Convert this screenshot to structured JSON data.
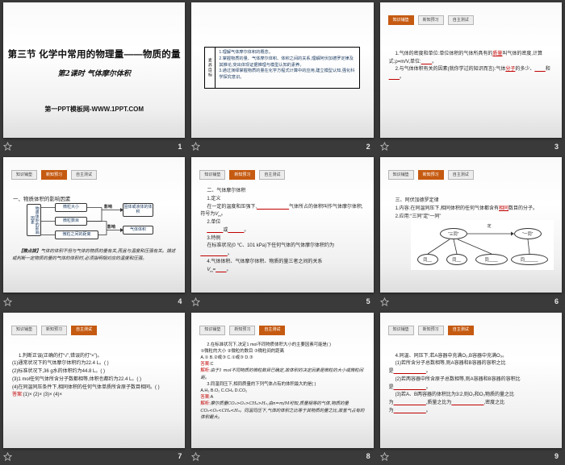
{
  "canvas": {
    "background": "#3A3A3A",
    "accent_orange": "#C55A11",
    "answer_red": "#C00000",
    "objective_blue": "#17375E"
  },
  "icons": {
    "transition_indicator": "star-icon"
  },
  "tabs": [
    "知识铺垫",
    "新知预习",
    "自主测试"
  ],
  "slides": {
    "s1": {
      "number": "1",
      "title": "第三节 化学中常用的物理量——物质的量",
      "subtitle": "第2课时  气体摩尔体积",
      "footer": "第一PPT模板网-WWW.1PPT.COM"
    },
    "s2": {
      "number": "2",
      "side_label": "素养目标",
      "items": [
        "1.理解气体摩尔体积的概念。",
        "2.掌握物质的量、气体摩尔体积、体积之间的关系,理解阿伏加德罗定律及其推论,突出体现证据推理与模型认知的素养。",
        "3.通过演绎掌握物质的量在化学方程式计算中的应用,建立模型认知,强化科学探究意识。"
      ]
    },
    "s3": {
      "number": "3",
      "active_tab": 0,
      "lines": [
        [
          {
            "t": "1.气体的密度和单位:单位体积的气体所具有的",
            "s": "n"
          },
          {
            "t": "质量",
            "s": "bl"
          },
          {
            "t": "叫气体的密度,计算式:ρ=m/V,单位:",
            "s": "n"
          },
          {
            "t": "____",
            "s": "bl"
          },
          {
            "t": "。",
            "s": "n"
          }
        ],
        [
          {
            "t": "2.与气体体积有关的因素(就你学过的知识而言):气体",
            "s": "n"
          },
          {
            "t": "分子",
            "s": "bl"
          },
          {
            "t": "的多少、",
            "s": "n"
          },
          {
            "t": "____",
            "s": "bl"
          },
          {
            "t": "和",
            "s": "n"
          },
          {
            "t": "____",
            "s": "bl"
          },
          {
            "t": "。",
            "s": "n"
          }
        ]
      ]
    },
    "s4": {
      "number": "4",
      "active_tab": 1,
      "heading": "一、物质体积的影响因素",
      "chart": {
        "root": "物质体积的影响因素",
        "factors": [
          "微粒大小",
          "微粒数目",
          "微粒之间的距离"
        ],
        "arrow_label": "影响",
        "outcomes": [
          "固体或液体的体积",
          "气体体积"
        ]
      },
      "note_label": "【微点拨】",
      "note": "气体的体积不但与气体的物质的量有关,而且与温度和压强有关。描述或判断一定物质的量的气体的体积时,必须指明相对应的温度和压强。"
    },
    "s5": {
      "number": "5",
      "active_tab": 1,
      "lines": [
        [
          {
            "t": "二、气体摩尔体积",
            "s": "n"
          }
        ],
        [
          {
            "t": "1.定义",
            "s": "n"
          }
        ],
        [
          {
            "t": "在一定的温度和压强下,",
            "s": "n"
          },
          {
            "t": "____________",
            "s": "bl"
          },
          {
            "t": "气体所占的体积叫作气体摩尔体积,符号为",
            "s": "n"
          },
          {
            "t": "V",
            "s": "i"
          },
          {
            "t": "m",
            "s": "sub"
          },
          {
            "t": "。",
            "s": "n"
          }
        ],
        [
          {
            "t": "2.单位",
            "s": "n"
          }
        ],
        [
          {
            "t": "______",
            "s": "bl"
          },
          {
            "t": "或",
            "s": "n"
          },
          {
            "t": "______",
            "s": "bl"
          },
          {
            "t": "。",
            "s": "n"
          }
        ],
        [
          {
            "t": "3.特例",
            "s": "n"
          }
        ],
        [
          {
            "t": "在标准状况(0 ℃、101 kPa)下任何气体的气体摩尔体积约为",
            "s": "n"
          }
        ],
        [
          {
            "t": "__________",
            "s": "bl"
          },
          {
            "t": "。",
            "s": "n"
          }
        ],
        [
          {
            "t": "4.气体体积、气体摩尔体积、物质的量三者之间的关系",
            "s": "n"
          }
        ],
        [
          {
            "t": "V",
            "s": "i"
          },
          {
            "t": "m",
            "s": "sub"
          },
          {
            "t": "=",
            "s": "n"
          },
          {
            "t": "____",
            "s": "bl"
          },
          {
            "t": "。",
            "s": "n"
          }
        ]
      ]
    },
    "s6": {
      "number": "6",
      "active_tab": 1,
      "lines": [
        [
          {
            "t": "三、阿伏加德罗定律",
            "s": "n"
          }
        ],
        [
          {
            "t": "1.内容:在同温同压下,相同体积的任何气体都含有",
            "s": "n"
          },
          {
            "t": "相同",
            "s": "bl"
          },
          {
            "t": "数目的分子。",
            "s": "n"
          }
        ],
        [
          {
            "t": "2.应用:“三同”定“一同”",
            "s": "n"
          }
        ]
      ],
      "diagram": {
        "left": "“三同”",
        "right": "“一同”",
        "arrow_label": "定",
        "left_children": [
          "同__",
          "同__",
          "同____"
        ],
        "right_child": "同______"
      }
    },
    "s7": {
      "number": "7",
      "active_tab": 2,
      "lines": [
        [
          {
            "t": "1.判断正误(正确的打“√”,错误的打“×”)。",
            "s": "n"
          }
        ],
        [
          {
            "t": "(1)通常状况下的气体摩尔体积约为22.4 L。(  )",
            "s": "n"
          }
        ],
        [
          {
            "t": "(2)标准状况下,36 g水的体积约为44.8 L。(  )",
            "s": "n"
          }
        ],
        [
          {
            "t": "(3)1 mol任何气体所含分子数都相等,体积也都约为22.4 L。(  )",
            "s": "n"
          }
        ],
        [
          {
            "t": "(4)在同温同压条件下,相同体积的任何气体单质所含原子数目相同。(  )",
            "s": "n"
          }
        ],
        [
          {
            "t": "答案:",
            "s": "r"
          },
          {
            "t": "(1)×  (2)×  (3)×  (4)×",
            "s": "n"
          }
        ]
      ]
    },
    "s8": {
      "number": "8",
      "active_tab": 2,
      "lines": [
        [
          {
            "t": "2.在标准状况下,决定1 mol不同物质体积大小的主要因素可能是(     )",
            "s": "n"
          }
        ],
        [
          {
            "t": "①微粒的大小  ②微粒的数目  ③微粒间的距离",
            "s": "n"
          }
        ],
        [
          {
            "t": "A.①  B.②或③    C.①或③    D.③",
            "s": "n"
          }
        ],
        [
          {
            "t": "答案:",
            "s": "r"
          },
          {
            "t": "C",
            "s": "n"
          }
        ],
        [
          {
            "t": "解析:",
            "s": "r"
          },
          {
            "t": "由于1 mol不同物质的微粒数目已确定,故体积的决定因素是微粒的大小或微粒间距。",
            "s": "k"
          }
        ],
        [
          {
            "t": "3.同温同压下,相同质量的下列气体占有的体积最大的是(     )",
            "s": "n"
          }
        ],
        [
          {
            "t": "A.H₂  B.O₂  C.CH₄ D.CO₂",
            "s": "n"
          }
        ],
        [
          {
            "t": "答案:",
            "s": "r"
          },
          {
            "t": "A",
            "s": "n"
          }
        ],
        [
          {
            "t": "解析:",
            "s": "r"
          },
          {
            "t": "摩尔质量CO₂>O₂>CH₄>H₂,由n=m/M可知,质量相等的气体,物质的量CO₂<O₂<CH₄<H₂。同温同压下,气体的体积之比等于其物质的量之比,故氢气占有的体积最大。",
            "s": "k"
          }
        ]
      ]
    },
    "s9": {
      "number": "9",
      "active_tab": 2,
      "lines": [
        [
          {
            "t": "4.同温、同压下,若A容器中充满O₂,B容器中充满O₃。",
            "s": "n"
          }
        ],
        [
          {
            "t": "(1)若所含分子总数相等,则A容器和B容器的容积之比",
            "s": "n"
          }
        ],
        [
          {
            "t": "是",
            "s": "n"
          },
          {
            "t": "____________",
            "s": "bl"
          },
          {
            "t": "。",
            "s": "n"
          }
        ],
        [
          {
            "t": "(2)若两容器中所含原子总数相等,则A容器和B容器的容积比",
            "s": "n"
          }
        ],
        [
          {
            "t": "是",
            "s": "n"
          },
          {
            "t": "____________",
            "s": "bl"
          },
          {
            "t": "。",
            "s": "n"
          }
        ],
        [
          {
            "t": "(3)若A、B两容器的体积比为3∶2,则O₂和O₃物质的量之比",
            "s": "n"
          }
        ],
        [
          {
            "t": "为",
            "s": "n"
          },
          {
            "t": "____________",
            "s": "bl"
          },
          {
            "t": ",质量之比为",
            "s": "n"
          },
          {
            "t": "____________",
            "s": "bl"
          },
          {
            "t": ",密度之比",
            "s": "n"
          }
        ],
        [
          {
            "t": "为",
            "s": "n"
          },
          {
            "t": "____________",
            "s": "bl"
          },
          {
            "t": "。",
            "s": "n"
          }
        ]
      ]
    }
  }
}
